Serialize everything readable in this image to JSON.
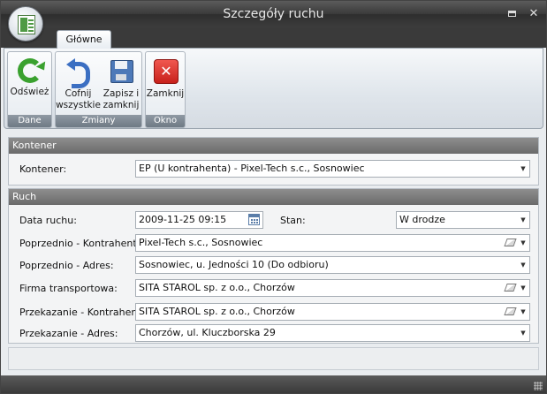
{
  "window": {
    "title": "Szczegóły ruchu",
    "controls": {
      "restore": "▭",
      "close": "✕"
    }
  },
  "ribbon": {
    "tabs": [
      {
        "label": "Główne",
        "active": true
      }
    ],
    "groups": [
      {
        "label": "Dane",
        "buttons": [
          {
            "label": "Odśwież",
            "icon": "refresh-icon"
          }
        ]
      },
      {
        "label": "Zmiany",
        "buttons": [
          {
            "label": "Cofnij wszystkie",
            "icon": "undo-icon"
          },
          {
            "label": "Zapisz i zamknij",
            "icon": "save-icon"
          }
        ]
      },
      {
        "label": "Okno",
        "buttons": [
          {
            "label": "Zamknij",
            "icon": "close-red-icon"
          }
        ]
      }
    ]
  },
  "kontener_section": {
    "header": "Kontener",
    "kontener_label": "Kontener:",
    "kontener_value": "EP (U kontrahenta) - Pixel-Tech s.c., Sosnowiec"
  },
  "ruch_section": {
    "header": "Ruch",
    "data_label": "Data ruchu:",
    "data_value": "2009-11-25 09:15",
    "stan_label": "Stan:",
    "stan_value": "W drodze",
    "prev_kontrahent_label": "Poprzednio - Kontrahent:",
    "prev_kontrahent_value": "Pixel-Tech s.c., Sosnowiec",
    "prev_adres_label": "Poprzednio - Adres:",
    "prev_adres_value": "Sosnowiec, u. Jedności 10 (Do odbioru)",
    "firma_label": "Firma transportowa:",
    "firma_value": "SITA STAROL sp. z o.o., Chorzów",
    "przek_kontrahent_label": "Przekazanie - Kontrahent:",
    "przek_kontrahent_value": "SITA STAROL sp. z o.o., Chorzów",
    "przek_adres_label": "Przekazanie - Adres:",
    "przek_adres_value": "Chorzów, ul. Kluczborska 29"
  },
  "colors": {
    "titlebar": "#3a3a3a",
    "section_header": "#7a7a7a",
    "ribbon_group_label": "#7a858f"
  }
}
